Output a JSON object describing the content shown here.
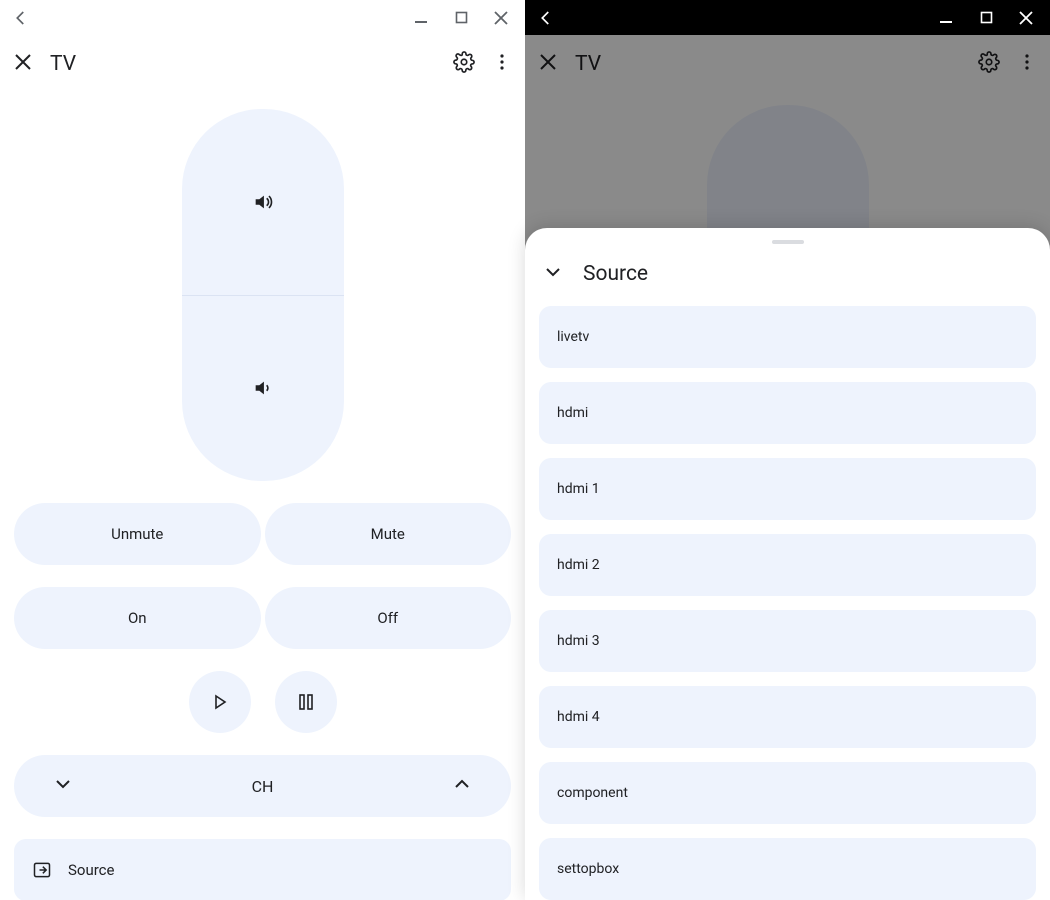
{
  "left": {
    "app_title": "TV",
    "buttons": {
      "unmute": "Unmute",
      "mute": "Mute",
      "on": "On",
      "off": "Off"
    },
    "channel_label": "CH",
    "source_label": "Source"
  },
  "right": {
    "app_title": "TV",
    "sheet_title": "Source",
    "sources": [
      "livetv",
      "hdmi",
      "hdmi 1",
      "hdmi 2",
      "hdmi 3",
      "hdmi 4",
      "component",
      "settopbox"
    ]
  }
}
